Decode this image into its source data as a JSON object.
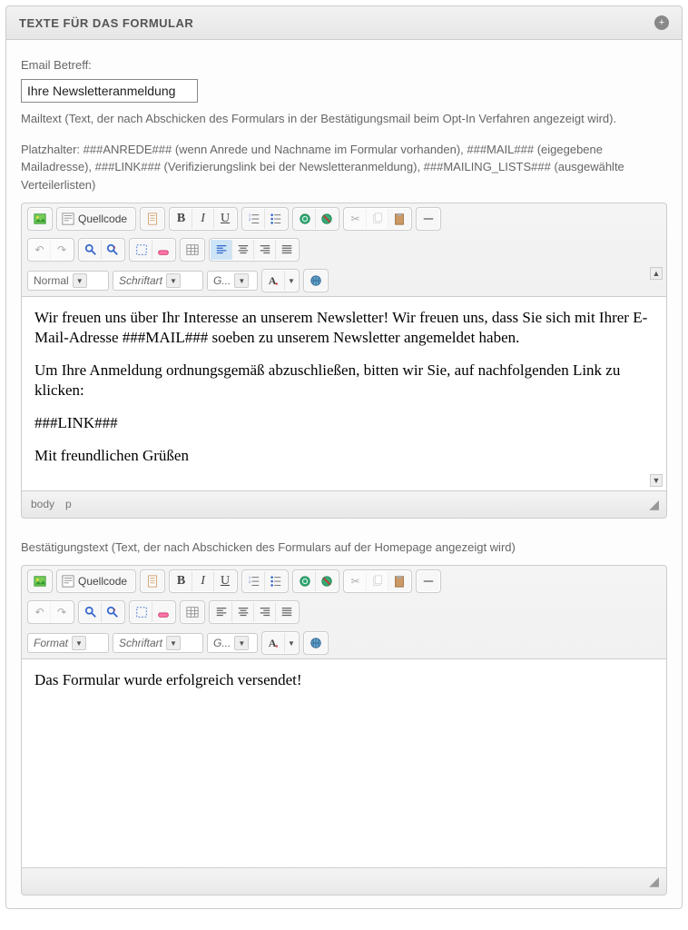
{
  "panel": {
    "title": "TEXTE FÜR DAS FORMULAR"
  },
  "email": {
    "label": "Email Betreff:",
    "value": "Ihre Newsletteranmeldung"
  },
  "mailtext": {
    "label": "Mailtext (Text, der nach Abschicken des Formulars in der Bestätigungsmail beim Opt-In Verfahren angezeigt wird).",
    "placeholders": "Platzhalter: ###ANREDE### (wenn Anrede und Nachname im Formular vorhanden), ###MAIL### (eigegebene Mailadresse), ###LINK### (Verifizierungslink bei der Newsletteranmeldung), ###MAILING_LISTS### (ausgewählte Verteilerlisten)"
  },
  "editor1": {
    "quellcode": "Quellcode",
    "format": "Normal",
    "font": "Schriftart",
    "size": "G...",
    "content": {
      "p1": "Wir freuen uns über Ihr Interesse an unserem Newsletter! Wir freuen uns, dass Sie sich mit Ihrer E-Mail-Adresse ###MAIL### soeben zu unserem Newsletter angemeldet haben.",
      "p2": "Um Ihre Anmeldung ordnungsgemäß abzuschließen, bitten wir Sie, auf nachfolgenden Link zu klicken:",
      "p3": "###LINK###",
      "p4": "Mit freundlichen Grüßen"
    },
    "path": "body p"
  },
  "confirm": {
    "label": "Bestätigungstext (Text, der nach Abschicken des Formulars auf der Homepage angezeigt wird)"
  },
  "editor2": {
    "quellcode": "Quellcode",
    "format": "Format",
    "font": "Schriftart",
    "size": "G...",
    "content": {
      "p1": "Das Formular wurde erfolgreich versendet!"
    }
  }
}
